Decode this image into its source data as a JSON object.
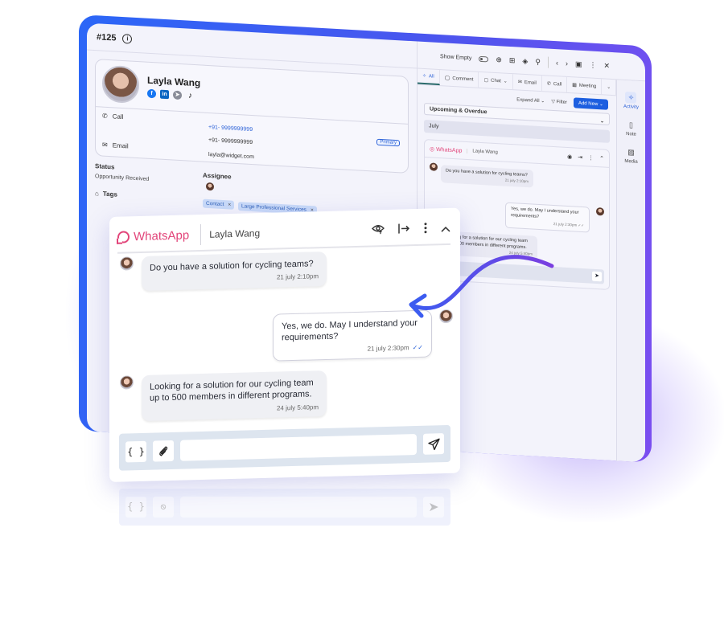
{
  "crm": {
    "ticket_id": "#125",
    "contact": {
      "name": "Layla Wang",
      "socials": [
        "facebook",
        "linkedin",
        "telegram",
        "tiktok"
      ],
      "call_label": "Call",
      "email_label": "Email",
      "phones": [
        "+91- 9999999999",
        "+91- 9999999999"
      ],
      "primary_badge": "Primary",
      "email": "layla@widget.com"
    },
    "status_label": "Status",
    "status_value": "Opportunity Received",
    "assignee_label": "Assignee",
    "tags_label": "Tags",
    "tags": [
      "Contact",
      "Large Professional Services"
    ],
    "toolbar": {
      "show_empty": "Show Empty",
      "icons": [
        "globe-icon",
        "hierarchy-icon",
        "layers-icon",
        "user-assign-icon",
        "chevron-left-icon",
        "chevron-right-icon",
        "panel-icon",
        "more-icon",
        "close-icon"
      ]
    },
    "tabs": [
      {
        "label": "All",
        "active": true
      },
      {
        "label": "Comment"
      },
      {
        "label": "Chat"
      },
      {
        "label": "Email"
      },
      {
        "label": "Call"
      },
      {
        "label": "Meeting"
      }
    ],
    "expand_all": "Expand All",
    "filter": "Filter",
    "add_new": "Add New",
    "section_filter": "Upcoming & Overdue",
    "month": "July",
    "side_rail": [
      {
        "label": "Activity",
        "active": true
      },
      {
        "label": "Note"
      },
      {
        "label": "Media"
      }
    ]
  },
  "whatsapp": {
    "brand": "WhatsApp",
    "contact": "Layla Wang",
    "brand_color": "#e2457a",
    "messages": [
      {
        "direction": "in",
        "text": "Do you have a solution for cycling teams?",
        "time": "21 july 2:10pm"
      },
      {
        "direction": "out",
        "text": "Yes, we do. May I understand your requirements?",
        "time": "21 july 2:30pm",
        "status": "read"
      },
      {
        "direction": "in",
        "text": "Looking for a solution for our cycling team up to 500 members in different programs.",
        "time": "24 july 5:40pm"
      }
    ],
    "composer": {
      "variables_label": "{ }",
      "placeholder": ""
    }
  }
}
